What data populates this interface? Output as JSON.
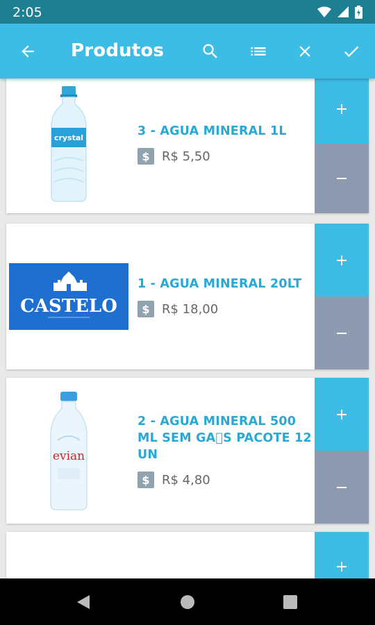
{
  "status_bar": {
    "time": "2:05"
  },
  "app_bar": {
    "title": "Produtos"
  },
  "products": [
    {
      "name": "3 - AGUA MINERAL 1L",
      "price": "R$  5,50",
      "image_label": "crystal"
    },
    {
      "name": "1 - AGUA MINERAL 20LT",
      "price": "R$  18,00",
      "image_label": "CASTELO"
    },
    {
      "name": "2 - AGUA MINERAL 500 ML SEM GA\u0000S PACOTE 12 UN",
      "price": "R$  4,80",
      "image_label": "evian"
    }
  ],
  "colors": {
    "accent": "#3dbde5",
    "status_bar": "#1f7f92",
    "minus": "#8d9ab0",
    "price_icon": "#8fa4ae",
    "product_name": "#27a9d6"
  },
  "icons": {
    "back": "arrow-left-icon",
    "search": "search-icon",
    "list": "list-icon",
    "close": "close-icon",
    "check": "check-icon",
    "plus": "plus-icon",
    "minus": "minus-icon",
    "price": "dollar-icon"
  }
}
